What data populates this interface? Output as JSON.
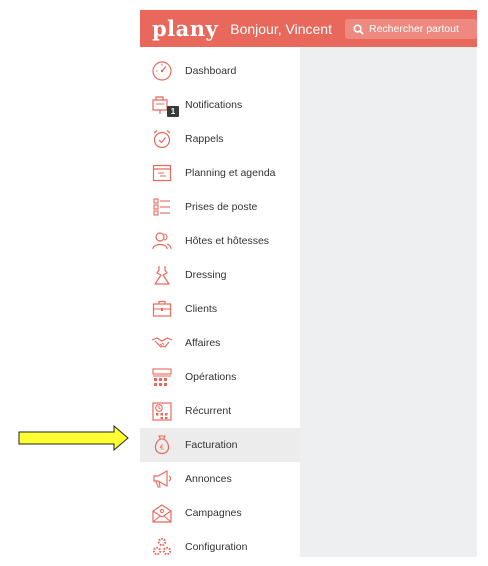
{
  "header": {
    "logo": "plany",
    "greeting": "Bonjour, Vincent",
    "search_label": "Rechercher partout"
  },
  "colors": {
    "brand": "#e8685c",
    "icon": "#e8685c",
    "active_bg": "#ececec",
    "arrow_fill": "#ffff33"
  },
  "sidebar": {
    "items": [
      {
        "label": "Dashboard",
        "icon": "gauge-icon"
      },
      {
        "label": "Notifications",
        "icon": "notifications-icon",
        "badge": "1"
      },
      {
        "label": "Rappels",
        "icon": "alarm-clock-icon"
      },
      {
        "label": "Planning et agenda",
        "icon": "calendar-icon"
      },
      {
        "label": "Prises de poste",
        "icon": "checklist-icon"
      },
      {
        "label": "Hôtes et hôtesses",
        "icon": "people-icon"
      },
      {
        "label": "Dressing",
        "icon": "dress-icon"
      },
      {
        "label": "Clients",
        "icon": "briefcase-icon"
      },
      {
        "label": "Affaires",
        "icon": "handshake-icon"
      },
      {
        "label": "Opérations",
        "icon": "operations-icon"
      },
      {
        "label": "Récurrent",
        "icon": "recurring-calendar-icon"
      },
      {
        "label": "Facturation",
        "icon": "money-bag-icon",
        "active": true
      },
      {
        "label": "Annonces",
        "icon": "megaphone-icon"
      },
      {
        "label": "Campagnes",
        "icon": "envelope-icon"
      },
      {
        "label": "Configuration",
        "icon": "gears-icon"
      }
    ]
  }
}
